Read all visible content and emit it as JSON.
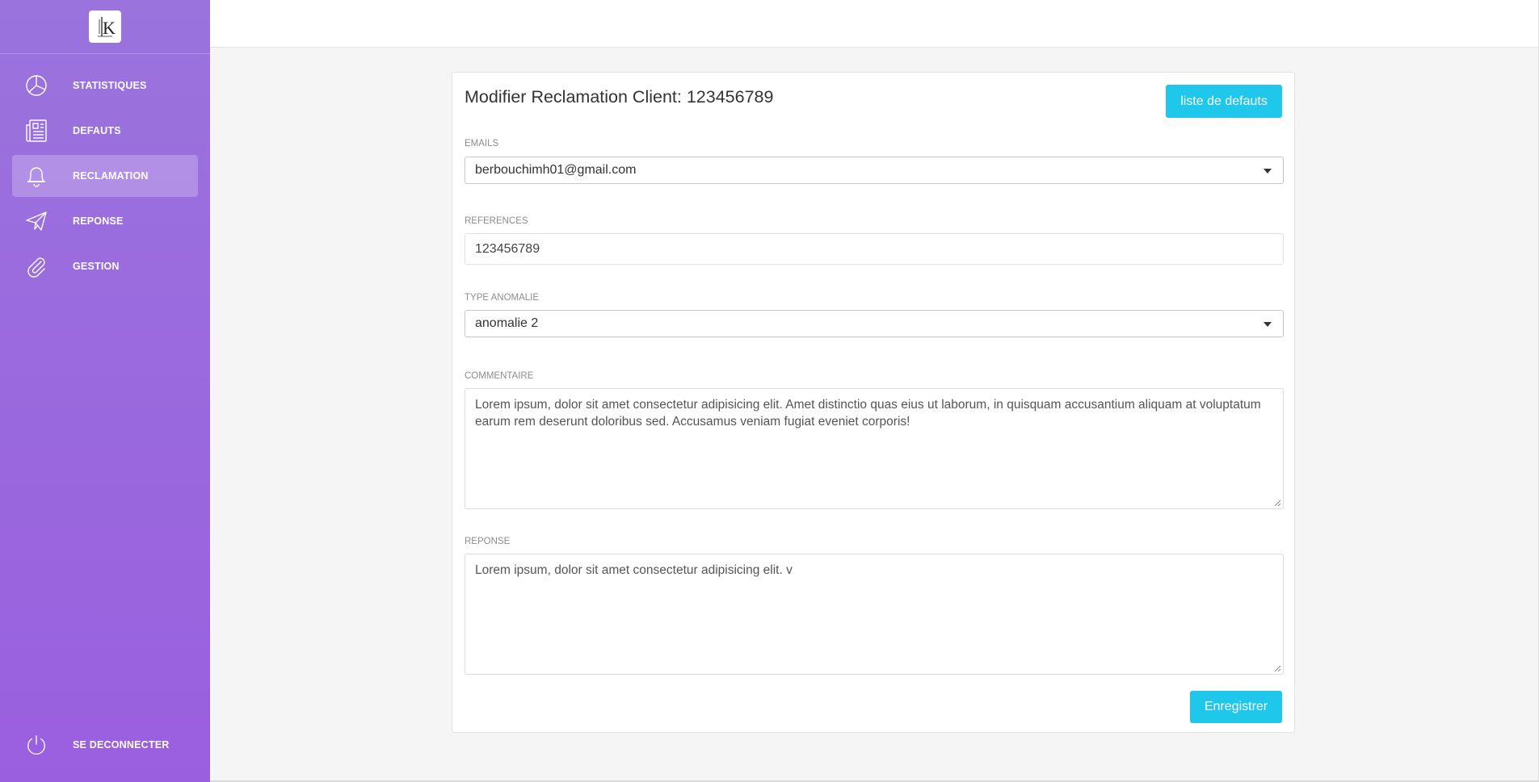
{
  "sidebar": {
    "logo_text": "K",
    "items": [
      {
        "label": "STATISTIQUES",
        "icon": "pie-chart-icon"
      },
      {
        "label": "DEFAUTS",
        "icon": "newspaper-icon"
      },
      {
        "label": "RECLAMATION",
        "icon": "bell-icon",
        "active": true
      },
      {
        "label": "REPONSE",
        "icon": "paper-plane-icon"
      },
      {
        "label": "GESTION",
        "icon": "paperclip-icon"
      }
    ],
    "logout_label": "SE DECONNECTER",
    "logout_icon": "power-icon",
    "gradient": [
      "#9a73dd",
      "#9a5fdf"
    ]
  },
  "form": {
    "title": "Modifier Reclamation Client: 123456789",
    "list_button": "liste de defauts",
    "emails_label": "EMAILS",
    "emails_value": "berbouchimh01@gmail.com",
    "references_label": "REFERENCES",
    "references_value": "123456789",
    "type_label": "TYPE ANOMALIE",
    "type_value": "anomalie 2",
    "commentaire_label": "COMMENTAIRE",
    "commentaire_value": "Lorem ipsum, dolor sit amet consectetur adipisicing elit. Amet distinctio quas eius ut laborum, in quisquam accusantium aliquam at voluptatum earum rem deserunt doloribus sed. Accusamus veniam fugiat eveniet corporis!",
    "reponse_label": "REPONSE",
    "reponse_value": "Lorem ipsum, dolor sit amet consectetur adipisicing elit. v",
    "save_button": "Enregistrer"
  },
  "colors": {
    "accent": "#1fc7ea",
    "active_item_bg": "rgba(255,255,255,0.23)"
  }
}
